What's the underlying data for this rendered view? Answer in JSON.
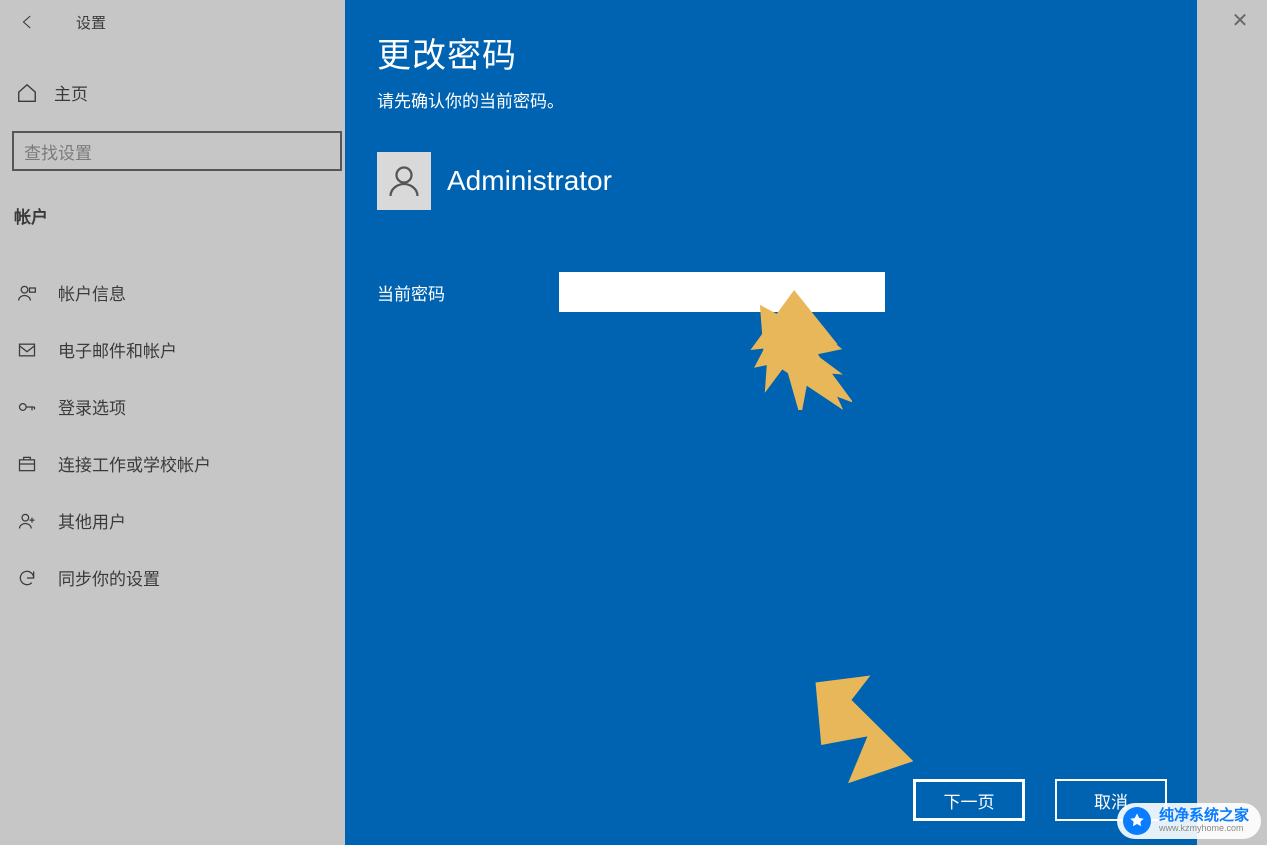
{
  "topbar": {
    "title": "设置",
    "close": "✕"
  },
  "sidebar": {
    "home": "主页",
    "search_placeholder": "查找设置",
    "section": "帐户",
    "items": [
      {
        "icon": "account-info-icon",
        "label": "帐户信息"
      },
      {
        "icon": "email-icon",
        "label": "电子邮件和帐户"
      },
      {
        "icon": "signin-icon",
        "label": "登录选项"
      },
      {
        "icon": "work-school-icon",
        "label": "连接工作或学校帐户"
      },
      {
        "icon": "other-users-icon",
        "label": "其他用户"
      },
      {
        "icon": "sync-icon",
        "label": "同步你的设置"
      }
    ]
  },
  "modal": {
    "title": "更改密码",
    "subtitle": "请先确认你的当前密码。",
    "username": "Administrator",
    "current_pw_label": "当前密码",
    "current_pw_value": "",
    "next_label": "下一页",
    "cancel_label": "取消"
  },
  "watermark": {
    "line1": "纯净系统之家",
    "line2": "www.kzmyhome.com"
  },
  "colors": {
    "modal_bg": "#0063B1",
    "arrow": "#E8B75A"
  }
}
